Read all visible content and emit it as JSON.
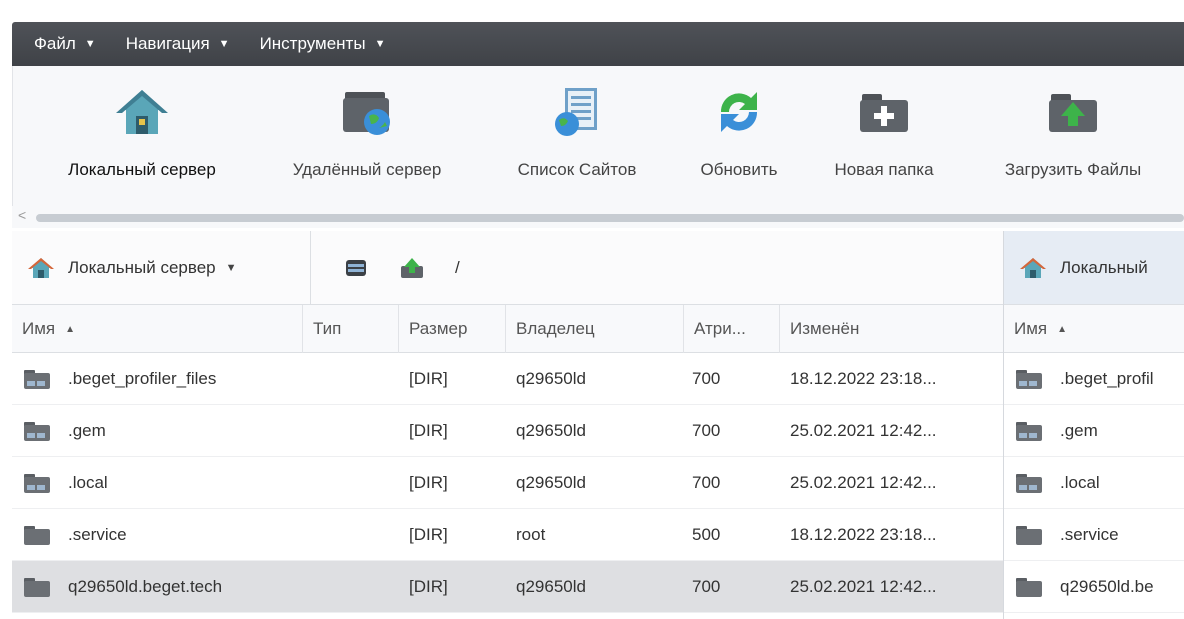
{
  "menubar": {
    "items": [
      {
        "label": "Файл"
      },
      {
        "label": "Навигация"
      },
      {
        "label": "Инструменты"
      }
    ]
  },
  "toolbar": {
    "local_server": "Локальный сервер",
    "remote_server": "Удалённый сервер",
    "site_list": "Список Сайтов",
    "refresh": "Обновить",
    "new_folder": "Новая папка",
    "upload": "Загрузить Файлы"
  },
  "left_panel": {
    "server_select": "Локальный сервер",
    "path": "/",
    "columns": {
      "name": "Имя",
      "type": "Тип",
      "size": "Размер",
      "owner": "Владелец",
      "attrs": "Атри...",
      "modified": "Изменён"
    },
    "rows": [
      {
        "name": ".beget_profiler_files",
        "size": "[DIR]",
        "owner": "q29650ld",
        "attrs": "700",
        "modified": "18.12.2022 23:18..."
      },
      {
        "name": ".gem",
        "size": "[DIR]",
        "owner": "q29650ld",
        "attrs": "700",
        "modified": "25.02.2021 12:42..."
      },
      {
        "name": ".local",
        "size": "[DIR]",
        "owner": "q29650ld",
        "attrs": "700",
        "modified": "25.02.2021 12:42..."
      },
      {
        "name": ".service",
        "size": "[DIR]",
        "owner": "root",
        "attrs": "500",
        "modified": "18.12.2022 23:18..."
      },
      {
        "name": "q29650ld.beget.tech",
        "size": "[DIR]",
        "owner": "q29650ld",
        "attrs": "700",
        "modified": "25.02.2021 12:42..."
      }
    ]
  },
  "right_panel": {
    "server_select": "Локальный",
    "columns": {
      "name": "Имя"
    },
    "rows": [
      {
        "name": ".beget_profil"
      },
      {
        "name": ".gem"
      },
      {
        "name": ".local"
      },
      {
        "name": ".service"
      },
      {
        "name": "q29650ld.be"
      }
    ]
  },
  "colors": {
    "menubar": "#45484d",
    "selected_row": "#dedfe2",
    "folder_dark": "#6b6f74",
    "globe_blue": "#3a8fd8",
    "refresh_green": "#3db34a"
  }
}
